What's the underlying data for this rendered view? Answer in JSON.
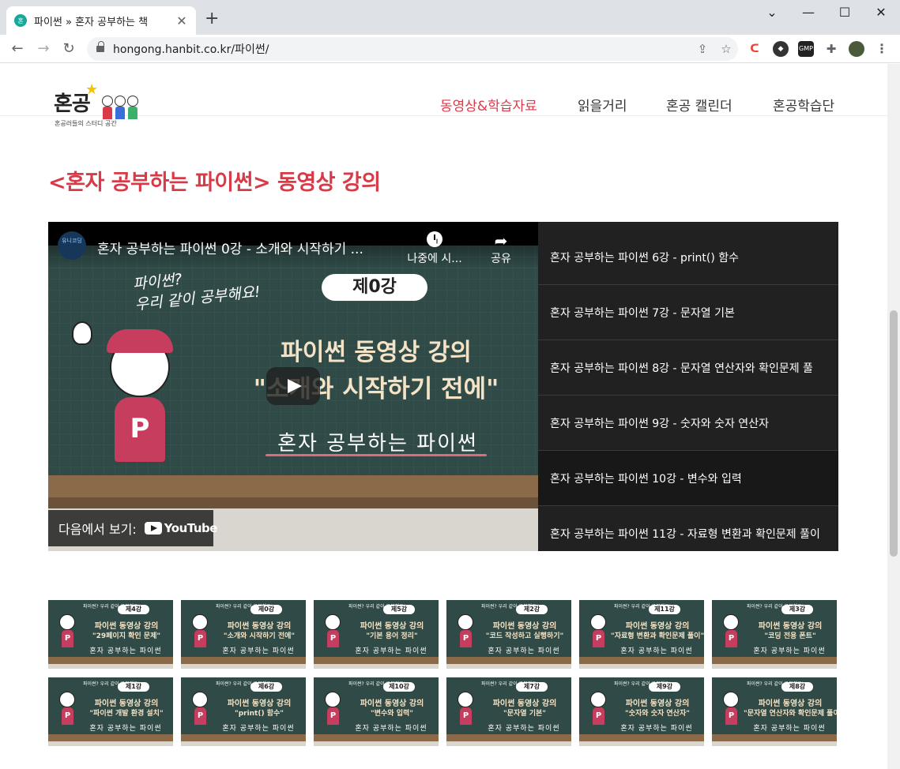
{
  "browser": {
    "tab_title": "파이썬 » 혼자 공부하는 책",
    "favicon_text": "혼",
    "new_tab": "+",
    "url": "hongong.hanbit.co.kr/파이썬/",
    "window_controls": [
      "⌄",
      "—",
      "☐",
      "✕"
    ],
    "extensions": [
      "GMP"
    ]
  },
  "site": {
    "logo_text": "혼공",
    "logo_sub": "혼공러들의 스터디 공간",
    "nav": [
      {
        "label": "동영상&학습자료",
        "active": true
      },
      {
        "label": "읽을거리",
        "active": false
      },
      {
        "label": "혼공 캘린더",
        "active": false
      },
      {
        "label": "혼공학습단",
        "active": false
      }
    ],
    "section_title": "<혼자 공부하는 파이썬> 동영상 강의"
  },
  "video": {
    "channel": "유니코딩",
    "title": "혼자 공부하는 파이썬 0강 - 소개와 시작하기 ...",
    "watch_later": "나중에 시...",
    "share": "공유",
    "chalk_text_1": "파이썬?",
    "chalk_text_2": "우리 같이 공부해요!",
    "episode": "제0강",
    "line1": "파이썬 동영상 강의",
    "line2": "\"소개와 시작하기 전에\"",
    "book": "혼자 공부하는 파이썬",
    "shirt_letter": "P",
    "watch_on": "다음에서 보기:",
    "youtube": "YouTube"
  },
  "playlist": [
    "혼자 공부하는 파이썬 6강 - print() 함수",
    "혼자 공부하는 파이썬 7강 - 문자열 기본",
    "혼자 공부하는 파이썬 8강 - 문자열 연산자와 확인문제 풀",
    "혼자 공부하는 파이썬 9강 - 숫자와 숫자 연산자",
    "혼자 공부하는 파이썬 10강 - 변수와 입력",
    "혼자 공부하는 파이썬 11강 - 자료형 변환과 확인문제 풀이"
  ],
  "thumbnails": [
    {
      "ep": "제4강",
      "title": "\"29페이지 확인 문제\""
    },
    {
      "ep": "제0강",
      "title": "\"소개와 시작하기 전에\""
    },
    {
      "ep": "제5강",
      "title": "\"기본 용어 정리\""
    },
    {
      "ep": "제2강",
      "title": "\"코드 작성하고 실행하기\""
    },
    {
      "ep": "제11강",
      "title": "\"자료형 변환과 확인문제 풀이\""
    },
    {
      "ep": "제3강",
      "title": "\"코딩 전용 폰트\""
    },
    {
      "ep": "제1강",
      "title": "\"파이썬 개발 환경 설치\""
    },
    {
      "ep": "제6강",
      "title": "\"print() 함수\""
    },
    {
      "ep": "제10강",
      "title": "\"변수와 입력\""
    },
    {
      "ep": "제7강",
      "title": "\"문자열 기본\""
    },
    {
      "ep": "제9강",
      "title": "\"숫자와 숫자 연산자\""
    },
    {
      "ep": "제8강",
      "title": "\"문자열 연산자와 확인문제 풀이\""
    }
  ],
  "thumb_common": {
    "line1": "파이썬 동영상 강의",
    "book": "혼자 공부하는 파이썬",
    "scribble": "파이썬? 우리 같이 공부해요!",
    "letter": "P"
  }
}
